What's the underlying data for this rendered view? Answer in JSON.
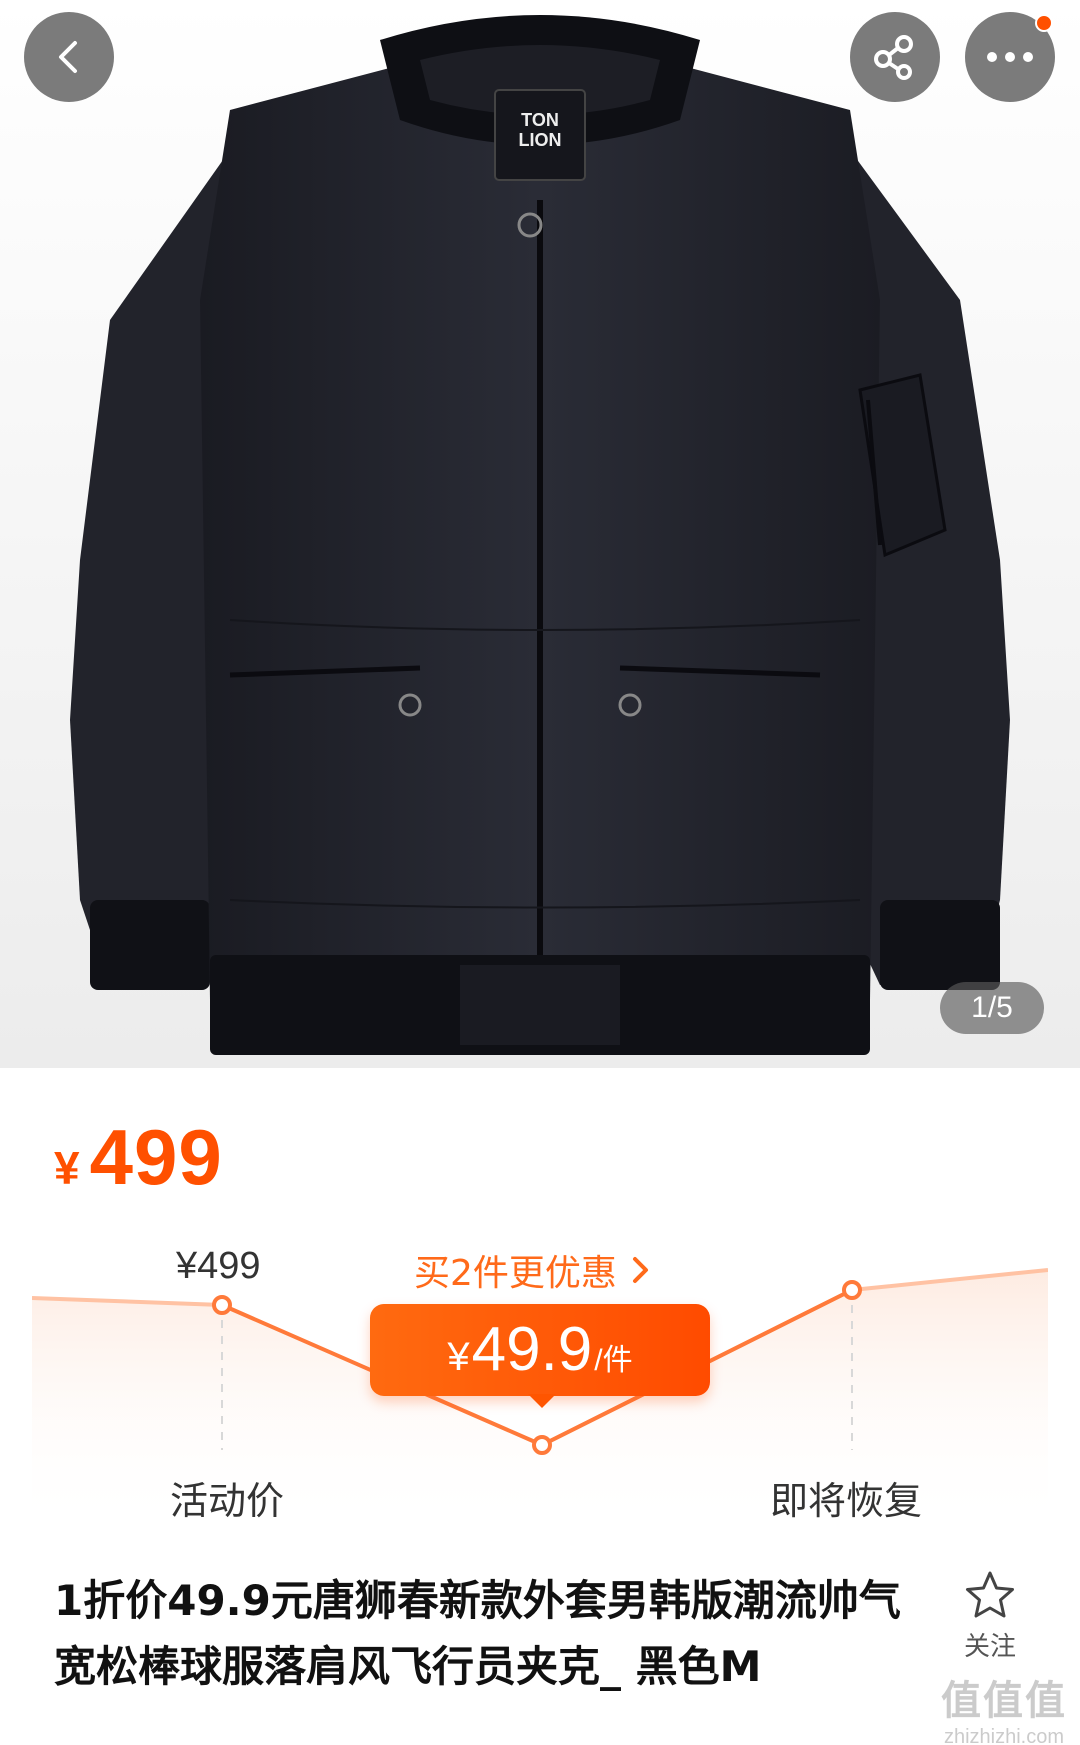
{
  "gallery": {
    "page_indicator": "1/5",
    "brand_tag_line1": "TON",
    "brand_tag_line2": "LION"
  },
  "price": {
    "currency": "¥",
    "value": "499"
  },
  "price_curve": {
    "original_price": "¥499",
    "promo_link": "买2件更优惠",
    "deal_currency": "¥",
    "deal_price": "49.9",
    "deal_unit": "/件",
    "label_activity": "活动价",
    "label_restore": "即将恢复"
  },
  "product": {
    "title": "1折价49.9元唐狮春新款外套男韩版潮流帅气宽松棒球服落肩风飞行员夹克_ 黑色M",
    "follow_label": "关注"
  },
  "watermark": {
    "text": "值值值",
    "url": "zhizhizhi.com"
  },
  "colors": {
    "accent": "#ff5000",
    "icon_bg": "#646464"
  },
  "icons": [
    "back-icon",
    "share-icon",
    "more-icon",
    "star-icon"
  ]
}
